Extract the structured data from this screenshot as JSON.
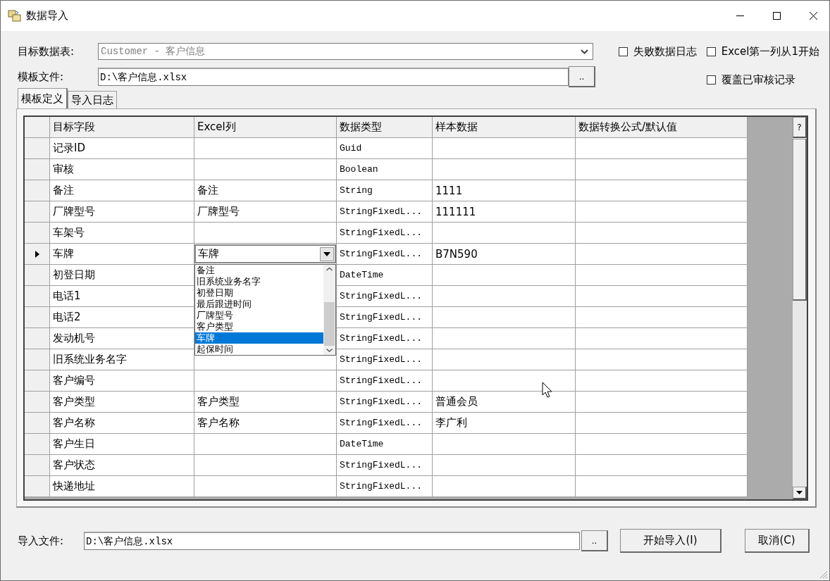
{
  "window": {
    "title": "数据导入"
  },
  "target_table": {
    "label": "目标数据表:",
    "value": "Customer - 客户信息"
  },
  "template_file": {
    "label": "模板文件:",
    "value": "D:\\客户信息.xlsx",
    "browse": ".."
  },
  "options": [
    {
      "label": "失败数据日志",
      "checked": false
    },
    {
      "label": "Excel第一列从1开始",
      "checked": false
    },
    {
      "label": "覆盖已审核记录",
      "checked": false
    }
  ],
  "tabs": [
    {
      "label": "模板定义",
      "selected": true
    },
    {
      "label": "导入日志",
      "selected": false
    }
  ],
  "grid": {
    "help": "?",
    "columns": [
      "目标字段",
      "Excel列",
      "数据类型",
      "样本数据",
      "数据转换公式/默认值"
    ],
    "rows": [
      {
        "field": "记录ID",
        "excel": "",
        "type": "Guid",
        "sample": "",
        "formula": "",
        "current": false
      },
      {
        "field": "审核",
        "excel": "",
        "type": "Boolean",
        "sample": "",
        "formula": "",
        "current": false
      },
      {
        "field": "备注",
        "excel": "备注",
        "type": "String",
        "sample": "1111",
        "formula": "",
        "current": false
      },
      {
        "field": "厂牌型号",
        "excel": "厂牌型号",
        "type": "StringFixedL...",
        "sample": "111111",
        "formula": "",
        "current": false
      },
      {
        "field": "车架号",
        "excel": "",
        "type": "StringFixedL...",
        "sample": "",
        "formula": "",
        "current": false
      },
      {
        "field": "车牌",
        "excel": "车牌",
        "type": "StringFixedL...",
        "sample": "B7N590",
        "formula": "",
        "current": true,
        "dropdown": [
          {
            "label": "备注",
            "selected": false
          },
          {
            "label": "旧系统业务名字",
            "selected": false
          },
          {
            "label": "初登日期",
            "selected": false
          },
          {
            "label": "最后跟进时间",
            "selected": false
          },
          {
            "label": "厂牌型号",
            "selected": false
          },
          {
            "label": "客户类型",
            "selected": false
          },
          {
            "label": "车牌",
            "selected": true
          },
          {
            "label": "起保时间",
            "selected": false
          }
        ]
      },
      {
        "field": "初登日期",
        "excel": "",
        "type": "DateTime",
        "sample": "",
        "formula": "",
        "current": false
      },
      {
        "field": "电话1",
        "excel": "",
        "type": "StringFixedL...",
        "sample": "",
        "formula": "",
        "current": false
      },
      {
        "field": "电话2",
        "excel": "",
        "type": "StringFixedL...",
        "sample": "",
        "formula": "",
        "current": false
      },
      {
        "field": "发动机号",
        "excel": "",
        "type": "StringFixedL...",
        "sample": "",
        "formula": "",
        "current": false
      },
      {
        "field": "旧系统业务名字",
        "excel": "",
        "type": "StringFixedL...",
        "sample": "",
        "formula": "",
        "current": false
      },
      {
        "field": "客户编号",
        "excel": "",
        "type": "StringFixedL...",
        "sample": "",
        "formula": "",
        "current": false
      },
      {
        "field": "客户类型",
        "excel": "客户类型",
        "type": "StringFixedL...",
        "sample": "普通会员",
        "formula": "",
        "current": false
      },
      {
        "field": "客户名称",
        "excel": "客户名称",
        "type": "StringFixedL...",
        "sample": "李广利",
        "formula": "",
        "current": false
      },
      {
        "field": "客户生日",
        "excel": "",
        "type": "DateTime",
        "sample": "",
        "formula": "",
        "current": false
      },
      {
        "field": "客户状态",
        "excel": "",
        "type": "StringFixedL...",
        "sample": "",
        "formula": "",
        "current": false
      },
      {
        "field": "快递地址",
        "excel": "",
        "type": "StringFixedL...",
        "sample": "",
        "formula": "",
        "current": false
      }
    ]
  },
  "import_file": {
    "label": "导入文件:",
    "value": "D:\\客户信息.xlsx",
    "browse": ".."
  },
  "buttons": [
    {
      "label": "开始导入(I)"
    },
    {
      "label": "取消(C)"
    }
  ]
}
